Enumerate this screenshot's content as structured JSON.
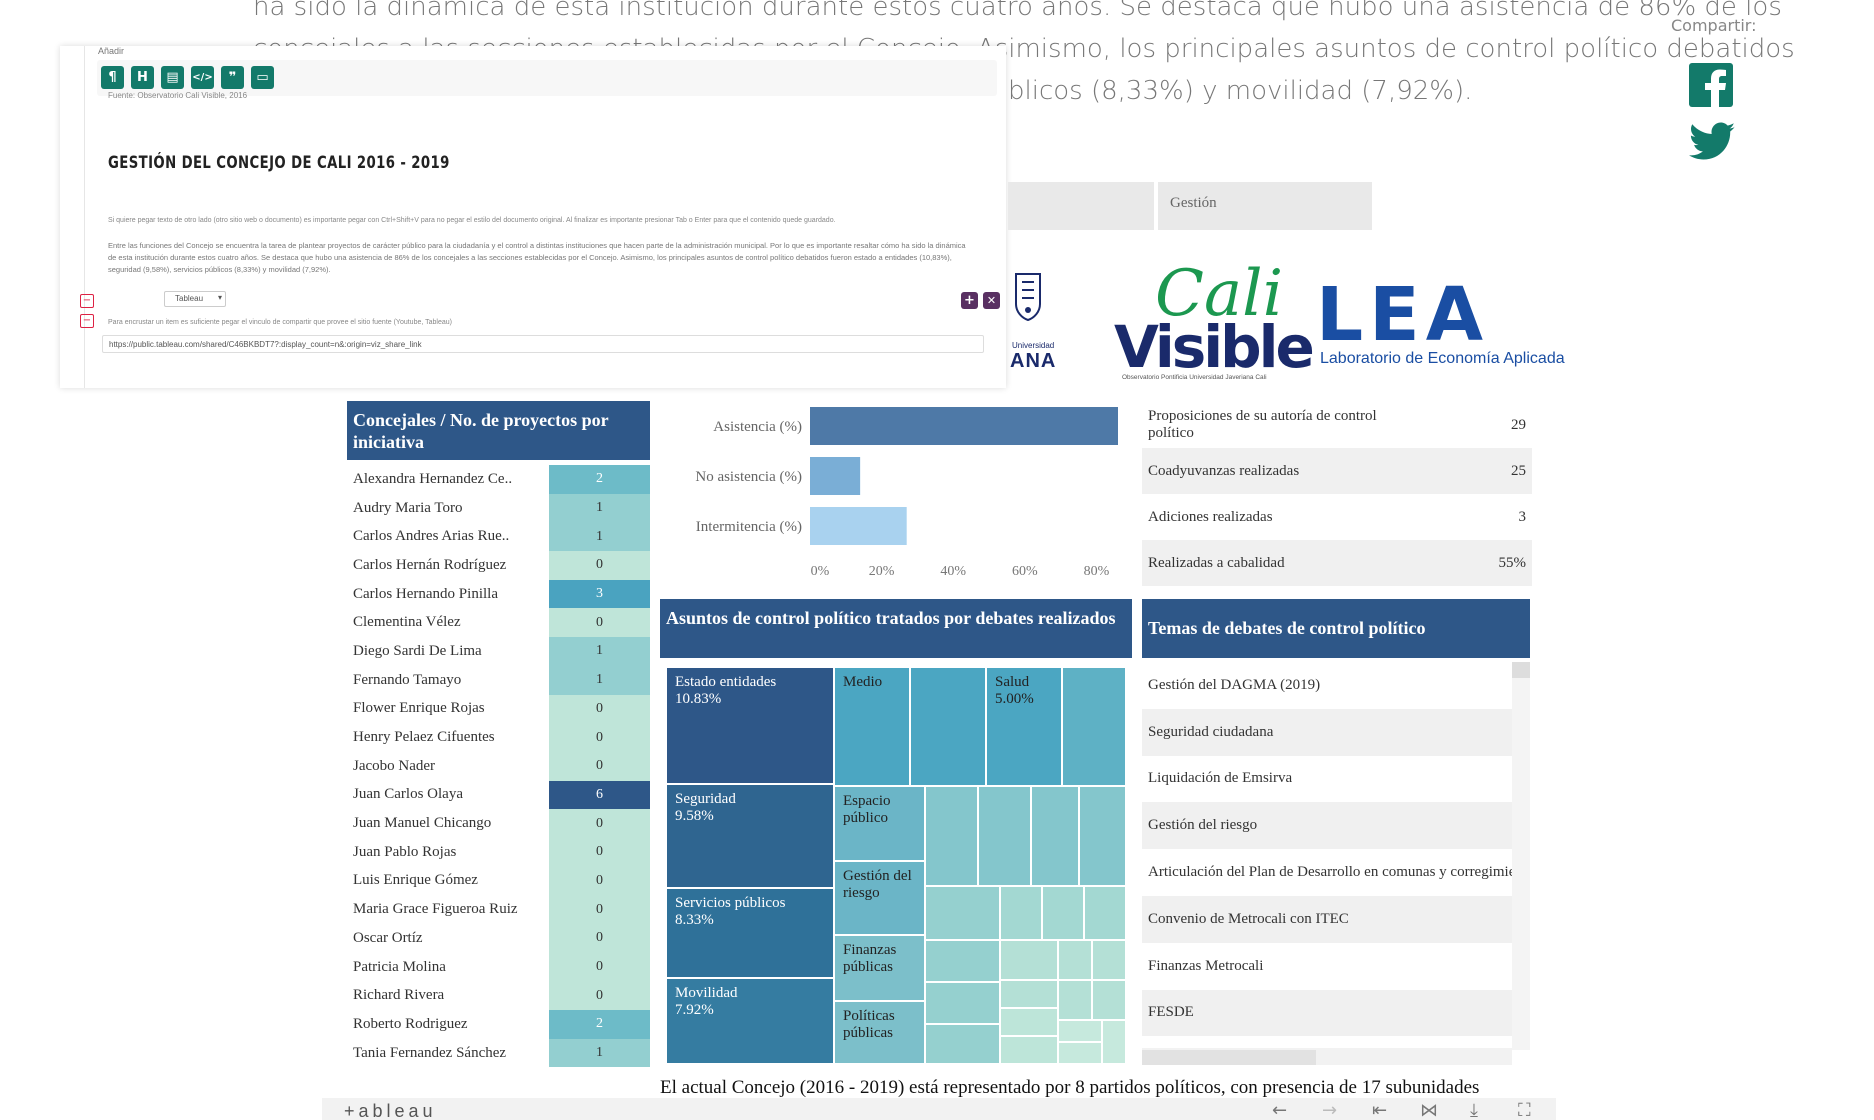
{
  "article": {
    "line1": "ha sido la dinámica de esta institución durante estos cuatro años. Se destaca que hubo una asistencia de 86% de los",
    "line2": "concejales a las secciones establecidas por el Concejo. Asimismo, los principales asuntos de control político debatidos",
    "line3": "blicos (8,33%) y movilidad (7,92%)."
  },
  "share": {
    "label": "Compartir:",
    "facebook_icon": "facebook-icon",
    "twitter_icon": "twitter-icon"
  },
  "editor": {
    "add_label": "Añadir",
    "toolbar": [
      "¶",
      "H",
      "▤",
      "</>",
      "❞",
      "▭"
    ],
    "source": "Fuente: Observatorio Cali Visible, 2016",
    "title": "GESTIÓN DEL CONCEJO DE CALI 2016 - 2019",
    "hint": "Si quiere pegar texto de otro lado (otro sitio web o documento) es importante pegar con Ctrl+Shift+V para no pegar el estilo del documento original. Al finalizar es importante presionar Tab o Enter para que el contenido quede guardado.",
    "body": "Entre las funciones del Concejo se encuentra la tarea de plantear proyectos de carácter público para la ciudadanía y el control a distintas instituciones que hacen parte de la administración municipal. Por lo que es importante resaltar cómo ha sido la dinámica de esta institución durante estos cuatro años. Se destaca que hubo una asistencia de 86% de los concejales a las secciones establecidas por el Concejo. Asimismo, los principales asuntos de control político debatidos fueron estado a entidades (10,83%), seguridad (9,58%), servicios públicos (8,33%) y movilidad (7,92%).",
    "select_value": "Tableau",
    "help": "Para encrustar un item es suficiente pegar el vinculo de compartir que provee el sitio fuente (Youtube, Tableau)",
    "url": "https://public.tableau.com/shared/C46BKBDT7?:display_count=n&:origin=viz_share_link"
  },
  "gestion_tab": "Gestión",
  "logos": {
    "uni_text": "Universidad",
    "uni_partial": "ANA",
    "cali": "Cali",
    "visible": "Visible",
    "observatorio": "Observatorio Pontificia Universidad Javeriana Cali",
    "lea": "LEA",
    "lab": "Laboratorio de Economía Aplicada"
  },
  "concejales": {
    "title": "Concejales / No. de proyectos por iniciativa",
    "rows": [
      {
        "name": "Alexandra Hernandez Ce..",
        "value": "2"
      },
      {
        "name": "Audry Maria Toro",
        "value": "1"
      },
      {
        "name": "Carlos Andres Arias Rue..",
        "value": "1"
      },
      {
        "name": "Carlos Hernán Rodríguez",
        "value": "0"
      },
      {
        "name": "Carlos Hernando Pinilla",
        "value": "3"
      },
      {
        "name": "Clementina Vélez",
        "value": "0"
      },
      {
        "name": "Diego Sardi De Lima",
        "value": "1"
      },
      {
        "name": "Fernando Tamayo",
        "value": "1"
      },
      {
        "name": "Flower Enrique Rojas",
        "value": "0"
      },
      {
        "name": "Henry Pelaez Cifuentes",
        "value": "0"
      },
      {
        "name": "Jacobo Nader",
        "value": "0"
      },
      {
        "name": "Juan Carlos Olaya",
        "value": "6"
      },
      {
        "name": "Juan Manuel Chicango",
        "value": "0"
      },
      {
        "name": "Juan Pablo Rojas",
        "value": "0"
      },
      {
        "name": "Luis Enrique Gómez",
        "value": "0"
      },
      {
        "name": "Maria Grace Figueroa Ruiz",
        "value": "0"
      },
      {
        "name": "Oscar Ortíz",
        "value": "0"
      },
      {
        "name": "Patricia Molina",
        "value": "0"
      },
      {
        "name": "Richard Rivera",
        "value": "0"
      },
      {
        "name": "Roberto Rodriguez",
        "value": "2"
      },
      {
        "name": "Tania Fernandez Sánchez",
        "value": "1"
      }
    ],
    "colors": {
      "0": "#bfe5d9",
      "1": "#93cfd0",
      "2": "#6dbbc8",
      "3": "#4aa3c0",
      "6": "#2e5788"
    }
  },
  "chart_data": {
    "type": "bar",
    "orientation": "horizontal",
    "categories": [
      "Asistencia (%)",
      "No asistencia (%)",
      "Intermitencia (%)"
    ],
    "values": [
      86,
      14,
      27
    ],
    "colors": [
      "#4e79a7",
      "#7aaed6",
      "#a9d2ef"
    ],
    "xlim": [
      0,
      86
    ],
    "xticks": [
      "0%",
      "20%",
      "40%",
      "60%",
      "80%"
    ],
    "xtick_values": [
      0,
      20,
      40,
      60,
      80
    ]
  },
  "asuntos": {
    "title": "Asuntos de control político tratados por debates realizados",
    "cells": [
      {
        "label": "Estado entidades",
        "pct": "10.83%"
      },
      {
        "label": "Seguridad",
        "pct": "9.58%"
      },
      {
        "label": "Servicios públicos",
        "pct": "8.33%"
      },
      {
        "label": "Movilidad",
        "pct": "7.92%"
      },
      {
        "label": "Medio",
        "pct": ""
      },
      {
        "label": "Salud",
        "pct": "5.00%"
      },
      {
        "label": "Espacio público",
        "pct": ""
      },
      {
        "label": "Gestión del riesgo",
        "pct": ""
      },
      {
        "label": "Finanzas públicas",
        "pct": ""
      },
      {
        "label": "Políticas públicas",
        "pct": ""
      }
    ]
  },
  "kpi": {
    "rows": [
      {
        "label": "Proposiciones de su autoría de control político",
        "value": "29"
      },
      {
        "label": "Coadyuvanzas realizadas",
        "value": "25"
      },
      {
        "label": "Adiciones realizadas",
        "value": "3"
      },
      {
        "label": "Realizadas a cabalidad",
        "value": "55%"
      }
    ]
  },
  "temas": {
    "title": "Temas de debates de control político",
    "rows": [
      "Gestión del DAGMA (2019)",
      "Seguridad ciudadana",
      "Liquidación de Emsirva",
      "Gestión del riesgo",
      "Articulación del Plan de Desarrollo en comunas y corregimie",
      "Convenio de Metrocali con ITEC",
      "Finanzas Metrocali",
      "FESDE"
    ]
  },
  "summary": "El actual Concejo (2016 - 2019) está representado por 8 partidos políticos, con presencia de 17 subunidades",
  "tableau_footer": {
    "logo": "+ableau",
    "controls": [
      "←",
      "→",
      "⇤",
      "⋈",
      "⤓",
      "⛶"
    ]
  }
}
